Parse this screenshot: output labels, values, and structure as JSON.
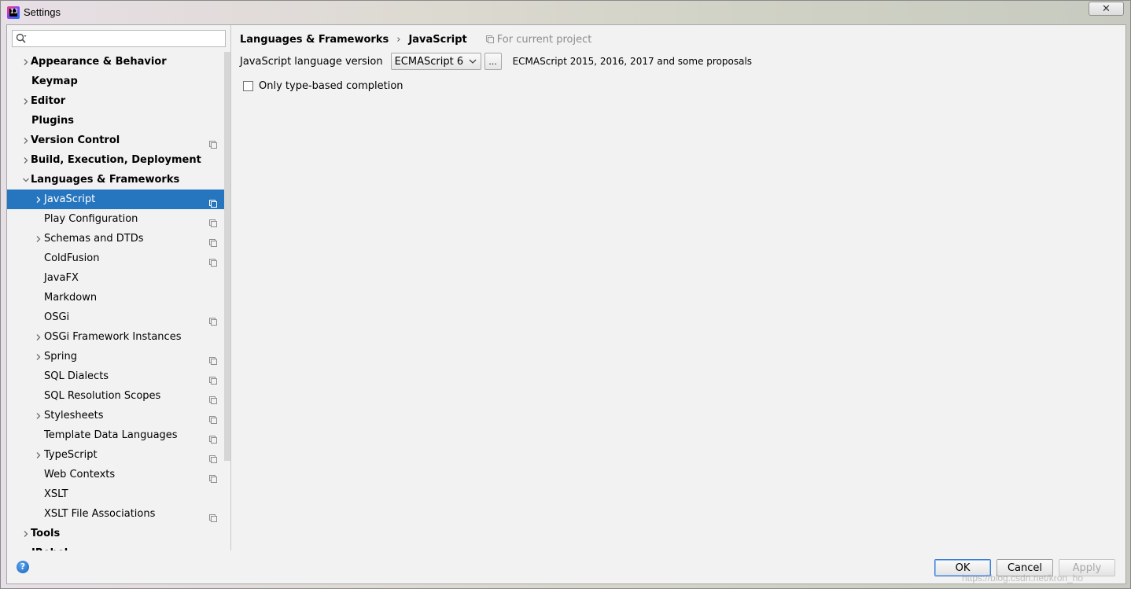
{
  "window": {
    "title": "Settings",
    "close_label": "✕"
  },
  "search": {
    "placeholder": ""
  },
  "sidebar": {
    "items": [
      {
        "label": "Appearance & Behavior",
        "level": 0,
        "arrow": "right",
        "bold": true,
        "project": false,
        "selected": false
      },
      {
        "label": "Keymap",
        "level": 0,
        "arrow": "none",
        "bold": true,
        "project": false,
        "selected": false
      },
      {
        "label": "Editor",
        "level": 0,
        "arrow": "right",
        "bold": true,
        "project": false,
        "selected": false
      },
      {
        "label": "Plugins",
        "level": 0,
        "arrow": "none",
        "bold": true,
        "project": false,
        "selected": false
      },
      {
        "label": "Version Control",
        "level": 0,
        "arrow": "right",
        "bold": true,
        "project": true,
        "selected": false
      },
      {
        "label": "Build, Execution, Deployment",
        "level": 0,
        "arrow": "right",
        "bold": true,
        "project": false,
        "selected": false
      },
      {
        "label": "Languages & Frameworks",
        "level": 0,
        "arrow": "down",
        "bold": true,
        "project": false,
        "selected": false
      },
      {
        "label": "JavaScript",
        "level": 1,
        "arrow": "right",
        "bold": false,
        "project": true,
        "selected": true
      },
      {
        "label": "Play Configuration",
        "level": 1,
        "arrow": "none",
        "bold": false,
        "project": true,
        "selected": false
      },
      {
        "label": "Schemas and DTDs",
        "level": 1,
        "arrow": "right",
        "bold": false,
        "project": true,
        "selected": false
      },
      {
        "label": "ColdFusion",
        "level": 1,
        "arrow": "none",
        "bold": false,
        "project": true,
        "selected": false
      },
      {
        "label": "JavaFX",
        "level": 1,
        "arrow": "none",
        "bold": false,
        "project": false,
        "selected": false
      },
      {
        "label": "Markdown",
        "level": 1,
        "arrow": "none",
        "bold": false,
        "project": false,
        "selected": false
      },
      {
        "label": "OSGi",
        "level": 1,
        "arrow": "none",
        "bold": false,
        "project": true,
        "selected": false
      },
      {
        "label": "OSGi Framework Instances",
        "level": 1,
        "arrow": "right",
        "bold": false,
        "project": false,
        "selected": false
      },
      {
        "label": "Spring",
        "level": 1,
        "arrow": "right",
        "bold": false,
        "project": true,
        "selected": false
      },
      {
        "label": "SQL Dialects",
        "level": 1,
        "arrow": "none",
        "bold": false,
        "project": true,
        "selected": false
      },
      {
        "label": "SQL Resolution Scopes",
        "level": 1,
        "arrow": "none",
        "bold": false,
        "project": true,
        "selected": false
      },
      {
        "label": "Stylesheets",
        "level": 1,
        "arrow": "right",
        "bold": false,
        "project": true,
        "selected": false
      },
      {
        "label": "Template Data Languages",
        "level": 1,
        "arrow": "none",
        "bold": false,
        "project": true,
        "selected": false
      },
      {
        "label": "TypeScript",
        "level": 1,
        "arrow": "right",
        "bold": false,
        "project": true,
        "selected": false
      },
      {
        "label": "Web Contexts",
        "level": 1,
        "arrow": "none",
        "bold": false,
        "project": true,
        "selected": false
      },
      {
        "label": "XSLT",
        "level": 1,
        "arrow": "none",
        "bold": false,
        "project": false,
        "selected": false
      },
      {
        "label": "XSLT File Associations",
        "level": 1,
        "arrow": "none",
        "bold": false,
        "project": true,
        "selected": false
      },
      {
        "label": "Tools",
        "level": 0,
        "arrow": "right",
        "bold": true,
        "project": false,
        "selected": false
      },
      {
        "label": "JRebel",
        "level": 0,
        "arrow": "none",
        "bold": true,
        "project": false,
        "selected": false
      }
    ]
  },
  "content": {
    "breadcrumb": {
      "parent": "Languages & Frameworks",
      "separator": "›",
      "current": "JavaScript"
    },
    "scope_note": "For current project",
    "language_version": {
      "label": "JavaScript language version",
      "selected": "ECMAScript 6",
      "more_button": "...",
      "description": "ECMAScript 2015, 2016, 2017 and some proposals"
    },
    "type_completion": {
      "label": "Only type-based completion",
      "checked": false
    }
  },
  "footer": {
    "help_label": "?",
    "ok_label": "OK",
    "cancel_label": "Cancel",
    "apply_label": "Apply"
  },
  "watermark": "https://blog.csdn.net/kron_ho",
  "colors": {
    "selection": "#2675bf",
    "panel": "#f2f2f2",
    "disabled_text": "#a8a8a8"
  }
}
